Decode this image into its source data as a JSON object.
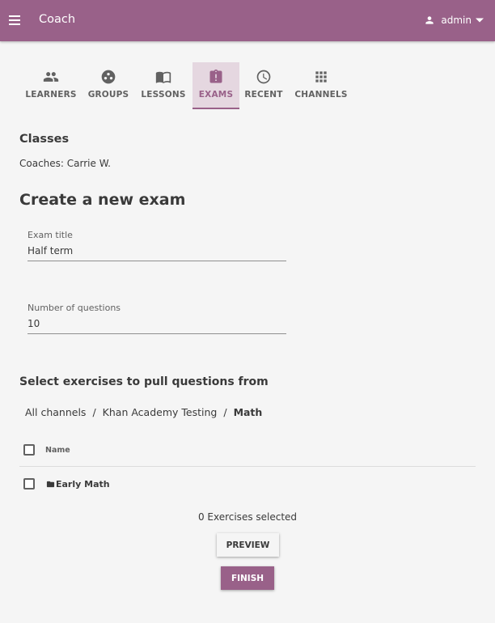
{
  "app": {
    "title": "Coach",
    "user_name": "admin"
  },
  "colors": {
    "brand": "#996189",
    "tab_active_bg": "#e5d7e0",
    "text": "#3a3a3a",
    "background": "#f5f5f5"
  },
  "tabs": [
    {
      "label": "LEARNERS",
      "icon": "people-icon",
      "active": false
    },
    {
      "label": "GROUPS",
      "icon": "groups-icon",
      "active": false
    },
    {
      "label": "LESSONS",
      "icon": "book-icon",
      "active": false
    },
    {
      "label": "EXAMS",
      "icon": "assignment-late-icon",
      "active": true
    },
    {
      "label": "RECENT",
      "icon": "clock-icon",
      "active": false
    },
    {
      "label": "CHANNELS",
      "icon": "apps-grid-icon",
      "active": false
    }
  ],
  "class_info": {
    "heading": "Classes",
    "coaches": "Coaches: Carrie W."
  },
  "form": {
    "heading": "Create a new exam",
    "exam_title": {
      "label": "Exam title",
      "value": "Half term"
    },
    "num_questions": {
      "label": "Number of questions",
      "value": "10"
    }
  },
  "exercises": {
    "heading": "Select exercises to pull questions from",
    "breadcrumb": [
      "All channels",
      "Khan Academy Testing",
      "Math"
    ],
    "table": {
      "header": "Name",
      "rows": [
        {
          "name": "Early Math",
          "icon": "folder-icon"
        }
      ]
    },
    "selected_count": "0 Exercises selected"
  },
  "buttons": {
    "preview": "PREVIEW",
    "finish": "FINISH"
  }
}
